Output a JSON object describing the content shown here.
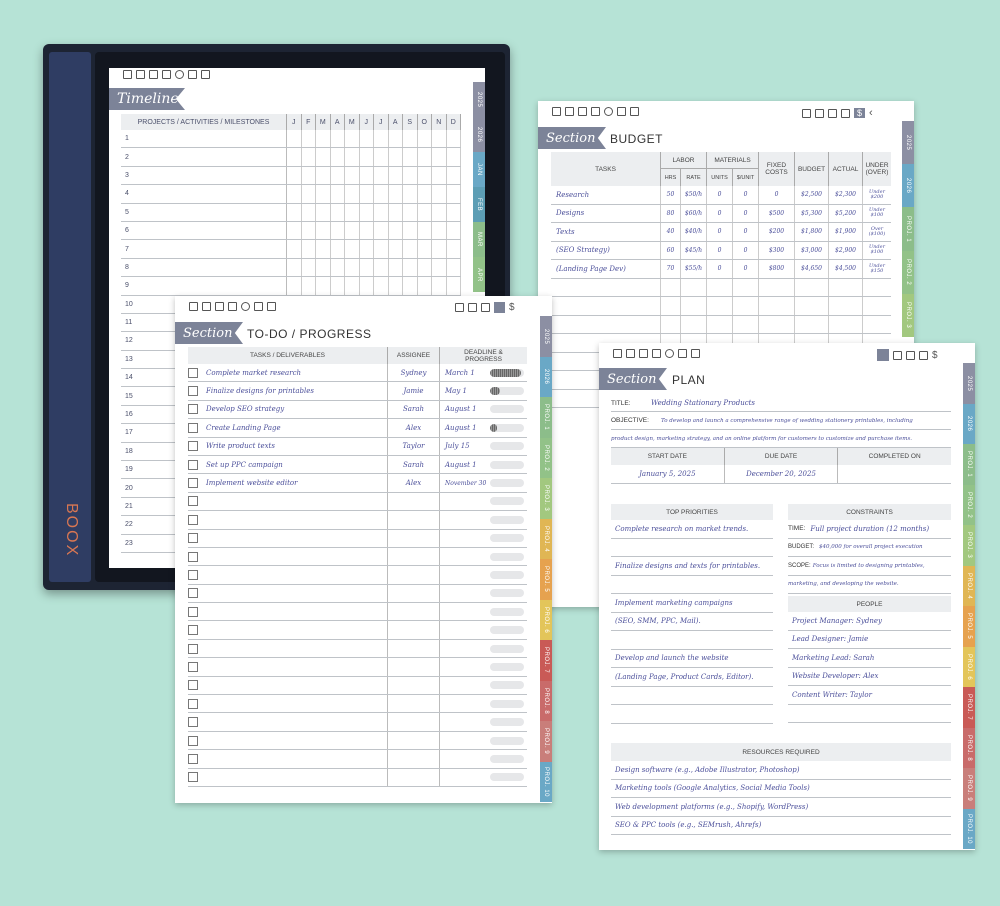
{
  "device": {
    "brand": "BOOX"
  },
  "timeline": {
    "title": "Timeline",
    "header": "PROJECTS / ACTIVITIES / MILESTONES",
    "months": [
      "J",
      "F",
      "M",
      "A",
      "M",
      "J",
      "J",
      "A",
      "S",
      "O",
      "N",
      "D"
    ],
    "rows": [
      "1",
      "2",
      "3",
      "4",
      "5",
      "6",
      "7",
      "8",
      "9",
      "10",
      "11",
      "12",
      "13",
      "14",
      "15",
      "16",
      "17",
      "18",
      "19",
      "20",
      "21",
      "22",
      "23"
    ],
    "tabs": [
      "2025",
      "2026",
      "JAN",
      "FEB",
      "MAR",
      "APR"
    ],
    "tab_colors": [
      "#8c8fa3",
      "#8c8fa3",
      "#6aa8c6",
      "#5d9eb5",
      "#8cbd8a",
      "#92c288"
    ]
  },
  "budget": {
    "section": "Section",
    "title": "BUDGET",
    "headers": {
      "tasks": "TASKS",
      "labor": "LABOR",
      "materials": "MATERIALS",
      "fixed": "FIXED COSTS",
      "budget": "BUDGET",
      "actual": "ACTUAL",
      "under": "UNDER (OVER)",
      "hrs": "HRS",
      "rate": "RATE",
      "units": "UNITS",
      "unit_price": "$/UNIT"
    },
    "rows": [
      {
        "task": "Research",
        "hrs": "50",
        "rate": "$50/h",
        "units": "0",
        "unit": "0",
        "fixed": "0",
        "budget": "$2,500",
        "actual": "$2,300",
        "under": "Under $200"
      },
      {
        "task": "Designs",
        "hrs": "80",
        "rate": "$60/h",
        "units": "0",
        "unit": "0",
        "fixed": "$500",
        "budget": "$5,300",
        "actual": "$5,200",
        "under": "Under $100"
      },
      {
        "task": "Texts",
        "hrs": "40",
        "rate": "$40/h",
        "units": "0",
        "unit": "0",
        "fixed": "$200",
        "budget": "$1,800",
        "actual": "$1,900",
        "under": "Over ($100)"
      },
      {
        "task": "(SEO Strategy)",
        "hrs": "60",
        "rate": "$45/h",
        "units": "0",
        "unit": "0",
        "fixed": "$300",
        "budget": "$3,000",
        "actual": "$2,900",
        "under": "Under $100"
      },
      {
        "task": "(Landing Page Dev)",
        "hrs": "70",
        "rate": "$55/h",
        "units": "0",
        "unit": "0",
        "fixed": "$800",
        "budget": "$4,650",
        "actual": "$4,500",
        "under": "Under $150"
      }
    ],
    "tabs": [
      "2025",
      "2026",
      "PROJ. 1",
      "PROJ. 2",
      "PROJ. 3"
    ],
    "tab_colors": [
      "#8c8fa3",
      "#6aa8c6",
      "#8cbd8a",
      "#92c288",
      "#a2c87f"
    ]
  },
  "todo": {
    "section": "Section",
    "title": "TO-DO / PROGRESS",
    "headers": {
      "tasks": "TASKS / DELIVERABLES",
      "assignee": "ASSIGNEE",
      "deadline": "DEADLINE & PROGRESS"
    },
    "rows": [
      {
        "task": "Complete market research",
        "assignee": "Sydney",
        "deadline": "March 1",
        "progress": 0.9
      },
      {
        "task": "Finalize designs for printables",
        "assignee": "Jamie",
        "deadline": "May 1",
        "progress": 0.3
      },
      {
        "task": "Develop SEO strategy",
        "assignee": "Sarah",
        "deadline": "August 1",
        "progress": 0
      },
      {
        "task": "Create Landing Page",
        "assignee": "Alex",
        "deadline": "August 1",
        "progress": 0.2
      },
      {
        "task": "Write product texts",
        "assignee": "Taylor",
        "deadline": "July 15",
        "progress": 0
      },
      {
        "task": "Set up PPC campaign",
        "assignee": "Sarah",
        "deadline": "August 1",
        "progress": 0
      },
      {
        "task": "Implement website editor",
        "assignee": "Alex",
        "deadline": "November 30",
        "progress": 0
      }
    ],
    "empty_rows": 16,
    "tabs": [
      "2025",
      "2026",
      "PROJ. 1",
      "PROJ. 2",
      "PROJ. 3",
      "PROJ. 4",
      "PROJ. 5",
      "PROJ. 6",
      "PROJ. 7",
      "PROJ. 8",
      "PROJ. 9",
      "PROJ. 10"
    ],
    "tab_colors": [
      "#8c8fa3",
      "#6aa8c6",
      "#8cbd8a",
      "#92c288",
      "#a2c87f",
      "#e0b654",
      "#e6a24f",
      "#e3c55a",
      "#c95a56",
      "#c96b6a",
      "#c97e7a",
      "#6aa8c6"
    ]
  },
  "plan": {
    "section": "Section",
    "heading": "PLAN",
    "title_label": "TITLE:",
    "title_value": "Wedding Stationary Products",
    "objective_label": "OBJECTIVE:",
    "objective_line1": "To develop and launch a comprehensive range of wedding stationery printables, including",
    "objective_line2": "product design, marketing strategy, and an online platform for customers to customize and purchase items.",
    "start_label": "START DATE",
    "due_label": "DUE DATE",
    "completed_label": "COMPLETED ON",
    "start_value": "January 5, 2025",
    "due_value": "December 20, 2025",
    "priorities_label": "TOP PRIORITIES",
    "priorities": [
      "Complete research on market trends.",
      "",
      "Finalize designs and texts for printables.",
      "",
      "Implement marketing campaigns",
      "(SEO, SMM, PPC, Mail).",
      "",
      "Develop and launch the website",
      "(Landing Page, Product Cards, Editor).",
      "",
      ""
    ],
    "constraints_label": "CONSTRAINTS",
    "time_label": "TIME:",
    "time_value": "Full project duration (12 months)",
    "budget_label": "BUDGET:",
    "budget_value": "$40,000 for overall project execution",
    "scope_label": "SCOPE:",
    "scope_value": "Focus is limited to designing printables,",
    "scope_value2": "marketing, and developing the website.",
    "people_label": "PEOPLE",
    "people": [
      "Project Manager: Sydney",
      "Lead Designer: Jamie",
      "Marketing Lead: Sarah",
      "Website Developer: Alex",
      "Content Writer: Taylor"
    ],
    "resources_label": "RESOURCES REQUIRED",
    "resources": [
      "Design software (e.g., Adobe Illustrator, Photoshop)",
      "Marketing tools (Google Analytics, Social Media Tools)",
      "Web development platforms (e.g., Shopify, WordPress)",
      "SEO & PPC tools (e.g., SEMrush, Ahrefs)"
    ],
    "tabs": [
      "2025",
      "2026",
      "PROJ. 1",
      "PROJ. 2",
      "PROJ. 3",
      "PROJ. 4",
      "PROJ. 5",
      "PROJ. 6",
      "PROJ. 7",
      "PROJ. 8",
      "PROJ. 9",
      "PROJ. 10"
    ],
    "tab_colors": [
      "#8c8fa3",
      "#6aa8c6",
      "#8cbd8a",
      "#92c288",
      "#a2c87f",
      "#e0b654",
      "#e6a24f",
      "#e3c55a",
      "#c95a56",
      "#c96b6a",
      "#c97e7a",
      "#6aa8c6"
    ]
  }
}
